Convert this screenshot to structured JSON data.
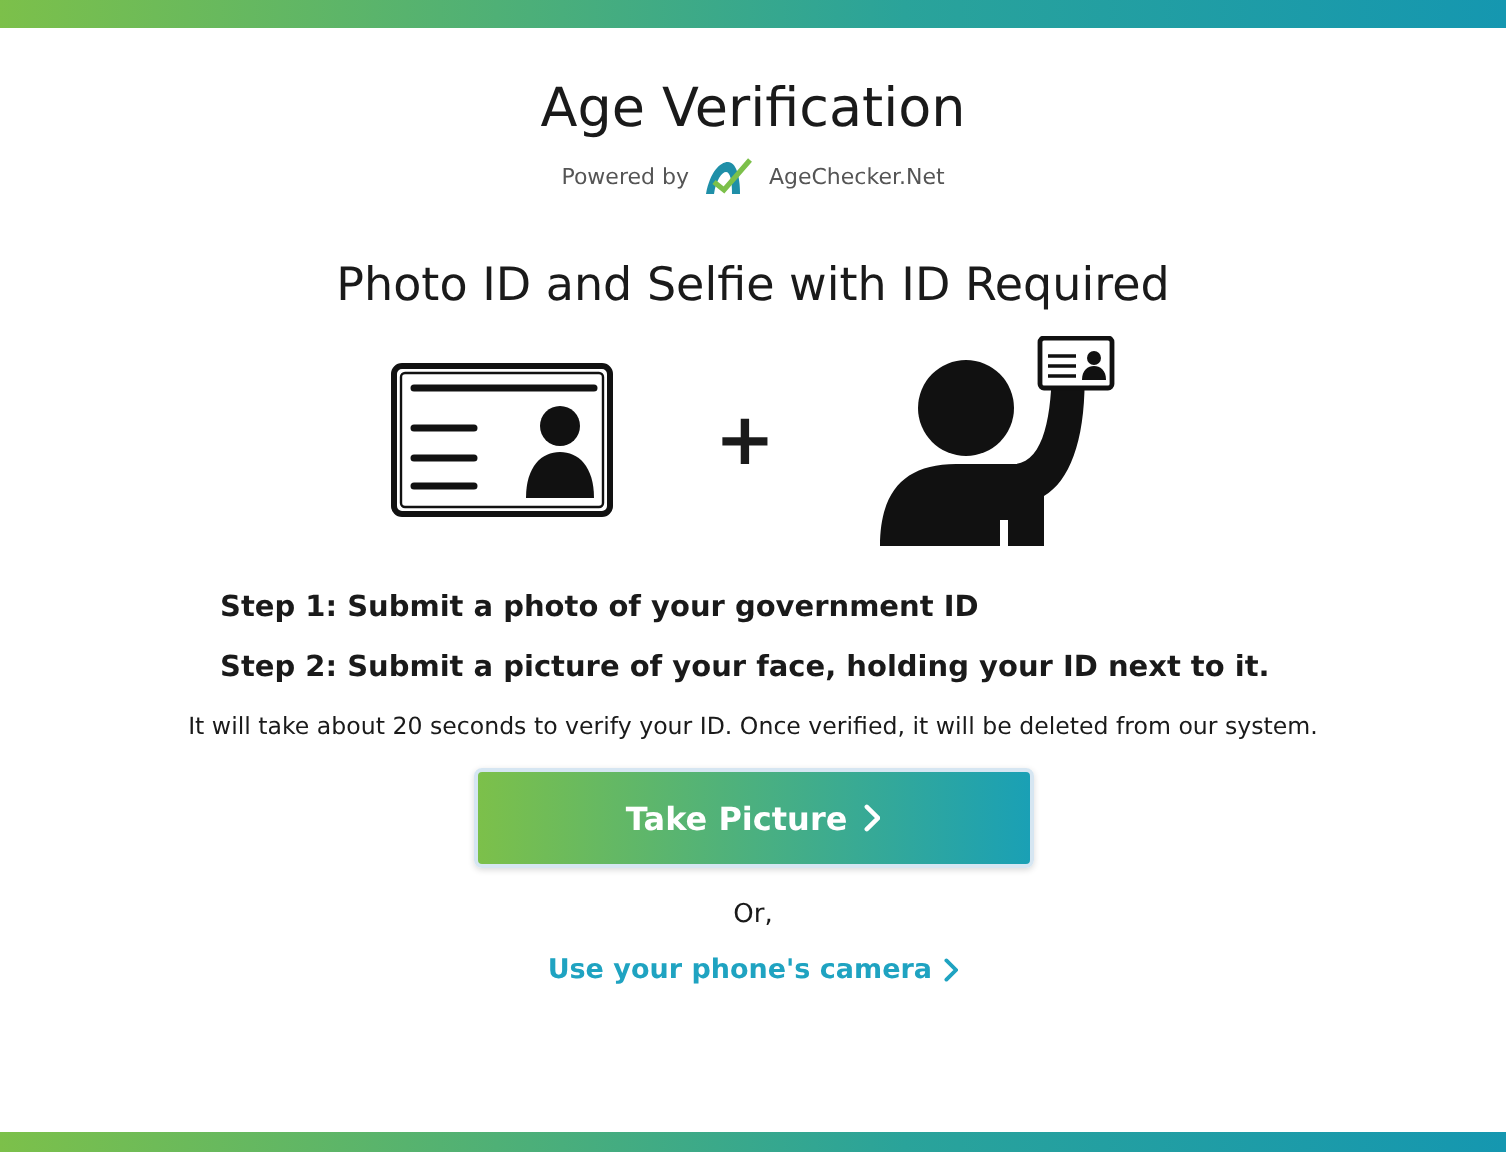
{
  "title": "Age Verification",
  "powered_by": {
    "label": "Powered by",
    "brand": "AgeChecker.Net"
  },
  "heading": "Photo ID and Selfie with ID Required",
  "plus": "+",
  "steps": [
    "Step 1: Submit a photo of your government ID",
    "Step 2: Submit a picture of your face, holding your ID next to it."
  ],
  "note": "It will take about 20 seconds to verify your ID. Once verified, it will be deleted from our system.",
  "primary_button": "Take Picture",
  "or": "Or,",
  "phone_link": "Use your phone's camera"
}
